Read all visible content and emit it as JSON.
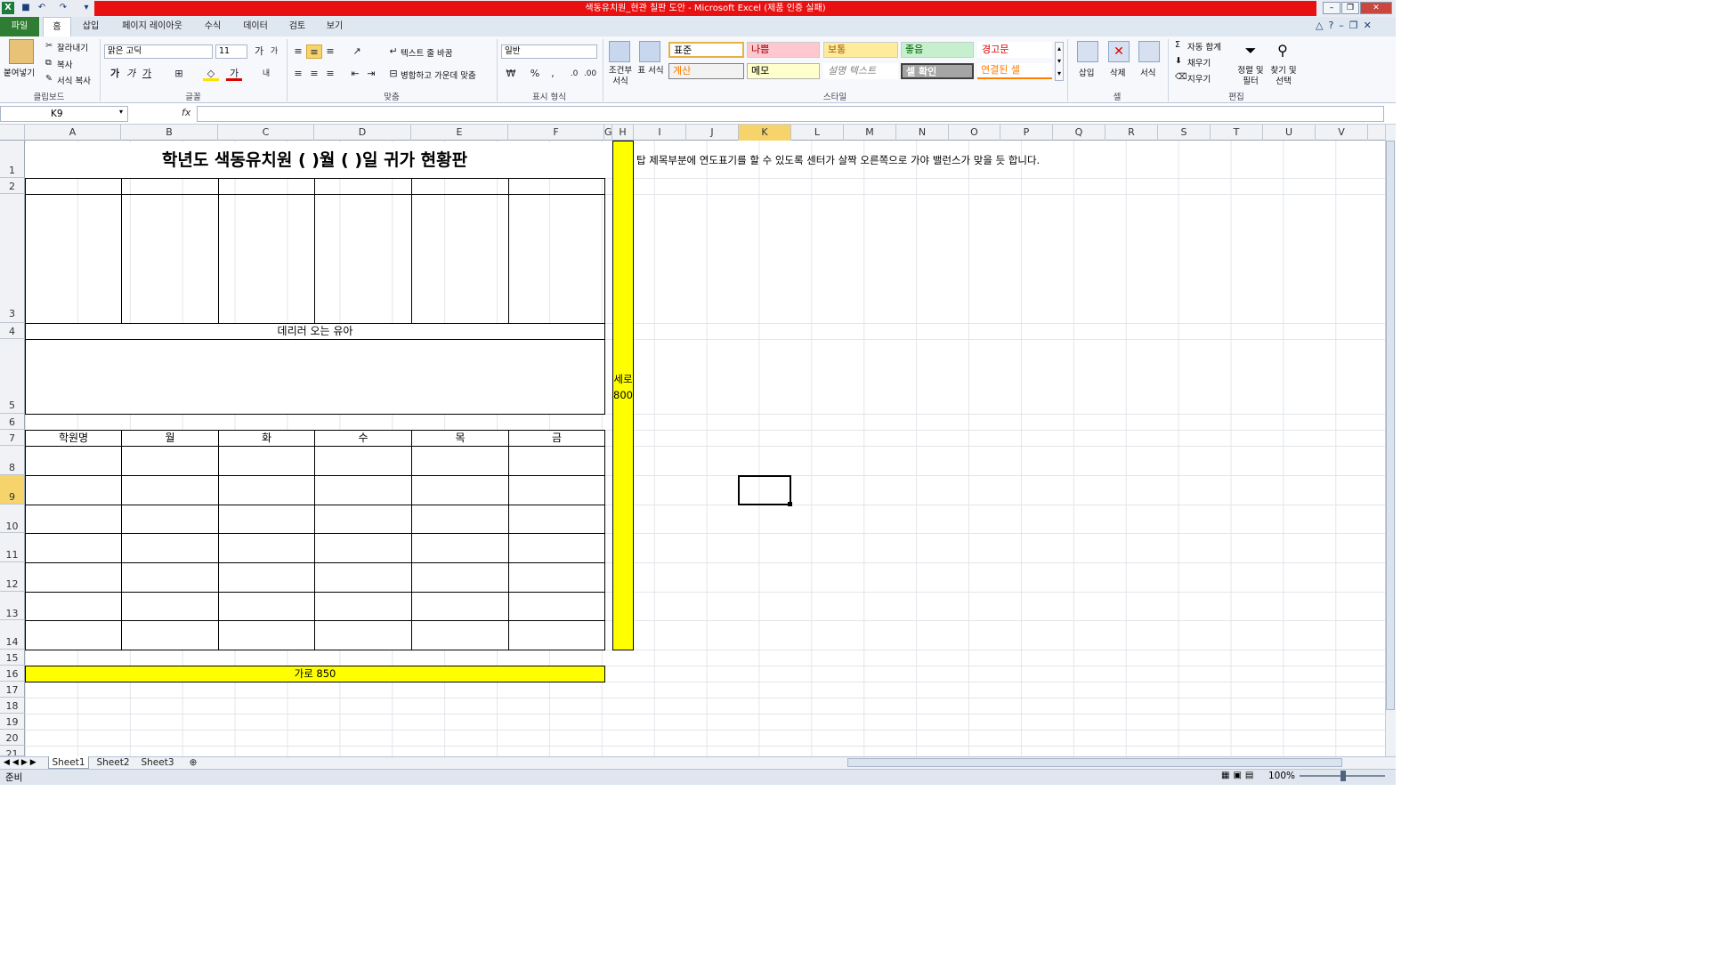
{
  "window": {
    "title": "색동유치원_현관 칠판 도안 - Microsoft Excel (제품 인증 실패)"
  },
  "tabs": [
    "파일",
    "홈",
    "삽입",
    "페이지 레이아웃",
    "수식",
    "데이터",
    "검토",
    "보기"
  ],
  "ribbon": {
    "clipboard": {
      "label": "클립보드",
      "paste": "붙여넣기",
      "cut": "잘라내기",
      "copy": "복사",
      "format_painter": "서식 복사"
    },
    "font": {
      "label": "글꼴",
      "name": "맑은 고딕",
      "size": "11"
    },
    "alignment": {
      "label": "맞춤",
      "wrap": "텍스트 줄 바꿈",
      "merge": "병합하고 가운데 맞춤"
    },
    "number": {
      "label": "표시 형식",
      "format": "일반"
    },
    "styles": {
      "label": "스타일",
      "conditional": "조건부 서식",
      "table": "표 서식",
      "cells": [
        {
          "text": "표준"
        },
        {
          "text": "나쁨"
        },
        {
          "text": "보통"
        },
        {
          "text": "좋음"
        },
        {
          "text": "경고문"
        },
        {
          "text": "계산"
        },
        {
          "text": "메모"
        },
        {
          "text": "설명 텍스트"
        },
        {
          "text": "셀 확인"
        },
        {
          "text": "연결된 셀"
        }
      ]
    },
    "cells": {
      "label": "셀",
      "insert": "삽입",
      "delete": "삭제",
      "format": "서식"
    },
    "editing": {
      "label": "편집",
      "autosum": "자동 합계",
      "fill": "채우기",
      "clear": "지우기",
      "sort": "정렬 및 필터",
      "find": "찾기 및 선택"
    }
  },
  "formula_bar": {
    "name_box": "K9",
    "fx": "fx",
    "value": ""
  },
  "columns": [
    "A",
    "B",
    "C",
    "D",
    "E",
    "F",
    "G",
    "H",
    "I",
    "J",
    "K",
    "L",
    "M",
    "N",
    "O",
    "P",
    "Q",
    "R",
    "S",
    "T",
    "U",
    "V"
  ],
  "rows": [
    "1",
    "2",
    "3",
    "4",
    "5",
    "6",
    "7",
    "8",
    "9",
    "10",
    "11",
    "12",
    "13",
    "14",
    "15",
    "16",
    "17",
    "18",
    "19",
    "20",
    "21"
  ],
  "sheet": {
    "title": "학년도 색동유치원 (      )월 (      )일 귀가 현황판",
    "pickup_label": "데리러 오는 유아",
    "header_row": [
      "학원명",
      "월",
      "화",
      "수",
      "목",
      "금"
    ],
    "vertical_label": "세로800",
    "horizontal_label": "가로 850",
    "note": "탑 제목부분에 연도표기를 할 수 있도록 센터가 살짝 오른쪽으로 가야 밸런스가 맞을 듯 합니다."
  },
  "sheet_tabs": [
    "Sheet1",
    "Sheet2",
    "Sheet3"
  ],
  "status": {
    "ready": "준비",
    "zoom": "100%"
  },
  "colors": {
    "highlight": "#ffff00",
    "excel_green": "#2e7d32",
    "title_red": "#e81010"
  }
}
